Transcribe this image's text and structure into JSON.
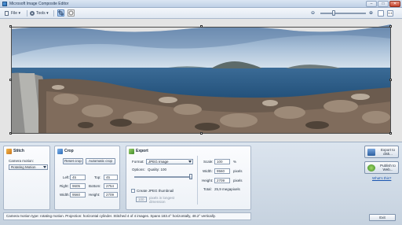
{
  "window": {
    "title": "Microsoft Image Composite Editor",
    "controls": {
      "minimize": "–",
      "maximize": "□",
      "close": "✕"
    }
  },
  "toolbar": {
    "file_label": "File",
    "tools_label": "Tools",
    "zoom_level": 0.3
  },
  "stitch": {
    "title": "Stitch",
    "camera_motion_label": "Camera motion:",
    "camera_motion_value": "Rotating Motion"
  },
  "crop": {
    "title": "Crop",
    "reset_label": "Reset crop",
    "auto_label": "Automatic crop",
    "left_label": "Left:",
    "left_value": "45",
    "top_label": "Top:",
    "top_value": "45",
    "right_label": "Right:",
    "right_value": "9605",
    "bottom_label": "Bottom:",
    "bottom_value": "2754",
    "width_label": "Width:",
    "width_value": "9560",
    "height_label": "Height:",
    "height_value": "2709"
  },
  "export": {
    "title": "Export",
    "format_label": "Format:",
    "format_value": "JPEG Image",
    "quality_label": "Options:",
    "quality_text": "Quality: 100",
    "quality_level": 1.0,
    "thumbnail_label": "Create JPEG thumbnail",
    "thumb_value": "100",
    "thumb_unit": "pixels in longest dimension",
    "scale_label": "Scale:",
    "scale_value": "100",
    "scale_unit": "%",
    "width_label": "Width:",
    "width_value": "9560",
    "width_unit": "pixels",
    "height_label": "Height:",
    "height_value": "2709",
    "height_unit": "pixels",
    "total_label": "Total:",
    "total_value": "25,9 megapixels"
  },
  "actions": {
    "export_disk": "Export to disk...",
    "publish_web": "Publish to Web...",
    "whats_this": "What's this?",
    "exit": "Exit"
  },
  "status": "Camera motion type: rotating motion. Projection: horizontal cylinder. Stitched 4 of 4 images. Spans 183.4° horizontally, 48.2° vertically."
}
